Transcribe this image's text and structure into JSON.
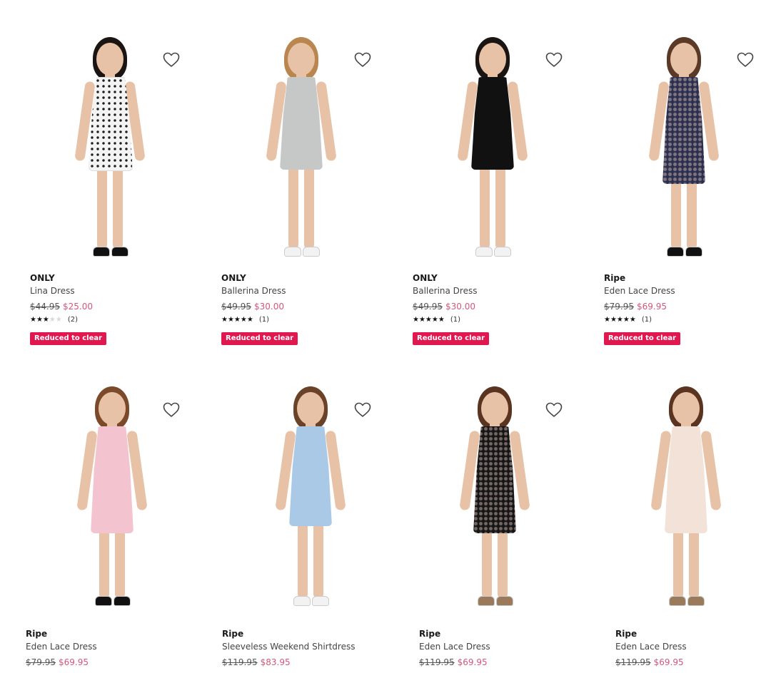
{
  "products": [
    {
      "brand": "ONLY",
      "name": "Lina Dress",
      "was": "$44.95",
      "now": "$25.00",
      "rating": 2.5,
      "reviews": "(2)",
      "badge": "Reduced to clear",
      "dress_color": "#f4f4f4",
      "hair_color": "#1a1513"
    },
    {
      "brand": "ONLY",
      "name": "Ballerina Dress",
      "was": "$49.95",
      "now": "$30.00",
      "rating": 5,
      "reviews": "(1)",
      "badge": "Reduced to clear",
      "dress_color": "#c5c8c6",
      "hair_color": "#b8864e"
    },
    {
      "brand": "ONLY",
      "name": "Ballerina Dress",
      "was": "$49.95",
      "now": "$30.00",
      "rating": 5,
      "reviews": "(1)",
      "badge": "Reduced to clear",
      "dress_color": "#111111",
      "hair_color": "#1a1513"
    },
    {
      "brand": "Ripe",
      "name": "Eden Lace Dress",
      "was": "$79.95",
      "now": "$69.95",
      "rating": 5,
      "reviews": "(1)",
      "badge": "Reduced to clear",
      "dress_color": "#2b2f4e",
      "hair_color": "#5a3a26"
    },
    {
      "brand": "Ripe",
      "name": "Eden Lace Dress",
      "was": "$79.95",
      "now": "$69.95",
      "dress_color": "#f3c4cf",
      "hair_color": "#7a4a2a"
    },
    {
      "brand": "Ripe",
      "name": "Sleeveless Weekend Shirtdress",
      "was": "$119.95",
      "now": "$83.95",
      "dress_color": "#a9c9e6",
      "hair_color": "#6a4228"
    },
    {
      "brand": "Ripe",
      "name": "Eden Lace Dress",
      "was": "$119.95",
      "now": "$69.95",
      "dress_color": "#151515",
      "hair_color": "#5a3420"
    },
    {
      "brand": "Ripe",
      "name": "Eden Lace Dress",
      "was": "$119.95",
      "now": "$69.95",
      "dress_color": "#f2e2d8",
      "hair_color": "#5a3420"
    }
  ],
  "colors": {
    "accent": "#e0184f",
    "sale_price": "#d4577a",
    "skin": "#e8c2a6"
  },
  "icons": {
    "wishlist": "heart-outline-icon",
    "star": "star-icon"
  }
}
